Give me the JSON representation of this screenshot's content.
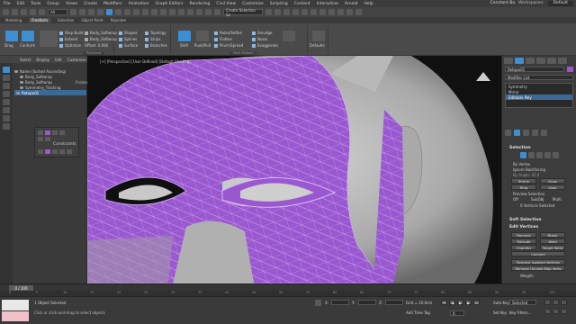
{
  "menubar": {
    "items": [
      "File",
      "Edit",
      "Tools",
      "Group",
      "Views",
      "Create",
      "Modifiers",
      "Animation",
      "Graph Editors",
      "Rendering",
      "Civil View",
      "Customize",
      "Scripting",
      "Content",
      "Interactive",
      "Arnold",
      "Help"
    ],
    "user": "Constant Ba",
    "workspaces_label": "Workspaces:",
    "workspace": "Default"
  },
  "toolbar": {
    "selection_filter": "All",
    "named_set": "Create Selection Se"
  },
  "ribbon": {
    "tabs": [
      "Modeling",
      "Freeform",
      "Selection",
      "Object Paint",
      "Populate"
    ],
    "active_tab": "Freeform",
    "groups": {
      "polydraw": {
        "title": "PolyDraw",
        "buttons": [
          "Drag",
          "Conform",
          "Step Build",
          "Extend",
          "Optimize"
        ],
        "extra": [
          "Body_Softwrap",
          "Offset: 0.000"
        ],
        "right": [
          "Shapes",
          "Splines",
          "Surface",
          "Topology",
          "Strips",
          "Branches"
        ]
      },
      "paint_deform": {
        "title": "Paint Deform",
        "buttons": [
          "Shift",
          "Push/Pull",
          "Relax/Soften",
          "Flatten",
          "Pinch/Spread",
          "Smudge",
          "Noise",
          "Exaggerate"
        ]
      },
      "defaults": {
        "label": "Defaults"
      }
    }
  },
  "left_panel": {
    "tabs": [
      "Select",
      "Display",
      "Edit",
      "Customize"
    ],
    "tree": [
      {
        "label": "Name (Sorted Ascending)",
        "sel": false
      },
      {
        "label": "Body_Softwrap",
        "sel": false
      },
      {
        "label": "Body_Softwrap",
        "sel": false
      },
      {
        "label": "Symmetry_Tracking",
        "sel": false
      },
      {
        "label": "Retopo01",
        "sel": true
      }
    ],
    "frozen_label": "Frozen",
    "float_title": "Constraints"
  },
  "viewport": {
    "label": "[+] [Perspective] [User Defined] [Default Shading]"
  },
  "right_panel": {
    "object_name": "Retopo01",
    "modifier_list": "Modifier List",
    "stack": [
      {
        "label": "Symmetry",
        "sel": false
      },
      {
        "label": "Mirror",
        "sel": false
      },
      {
        "label": "Editable Poly",
        "sel": true
      }
    ],
    "selection": {
      "title": "Selection",
      "by_vertex": "By Vertex",
      "ignore_backfacing": "Ignore Backfacing",
      "by_angle": "By Angle: 45.0",
      "shrink": "Shrink",
      "grow": "Grow",
      "ring": "Ring",
      "loop": "Loop",
      "preview_title": "Preview Selection",
      "preview_off": "Off",
      "subobj": "SubObj",
      "multi": "Multi",
      "vertices_selected": "0 Vertices Selected"
    },
    "soft_selection": "Soft Selection",
    "edit_vertices": {
      "title": "Edit Vertices",
      "remove": "Remove",
      "break": "Break",
      "extrude": "Extrude",
      "weld": "Weld",
      "chamfer": "Chamfer",
      "target_weld": "Target Weld",
      "connect": "Connect",
      "remove_isolated": "Remove Isolated Vertices",
      "remove_unused": "Remove Unused Map Verts",
      "weight": "Weight:"
    }
  },
  "timeline": {
    "slider": "0 / 100",
    "ticks": [
      "0",
      "5",
      "10",
      "15",
      "20",
      "25",
      "30",
      "35",
      "40",
      "45",
      "50",
      "55",
      "60",
      "65",
      "70",
      "75",
      "80",
      "85",
      "90",
      "95",
      "100"
    ]
  },
  "status": {
    "objects_selected": "1 Object Selected",
    "prompt": "Click or click-and-drag to select objects",
    "x_label": "X:",
    "y_label": "Y:",
    "z_label": "Z:",
    "grid": "Grid = 10.0cm",
    "add_time_tag": "Add Time Tag",
    "auto_key": "Auto Key",
    "selected": "Selected",
    "set_key": "Set Key",
    "key_filters": "Key Filters...",
    "frame": "0"
  },
  "colors": {
    "accent": "#3d8fd1",
    "retopo_purple": "#9a58d0",
    "viewport_bg": "#101010"
  }
}
